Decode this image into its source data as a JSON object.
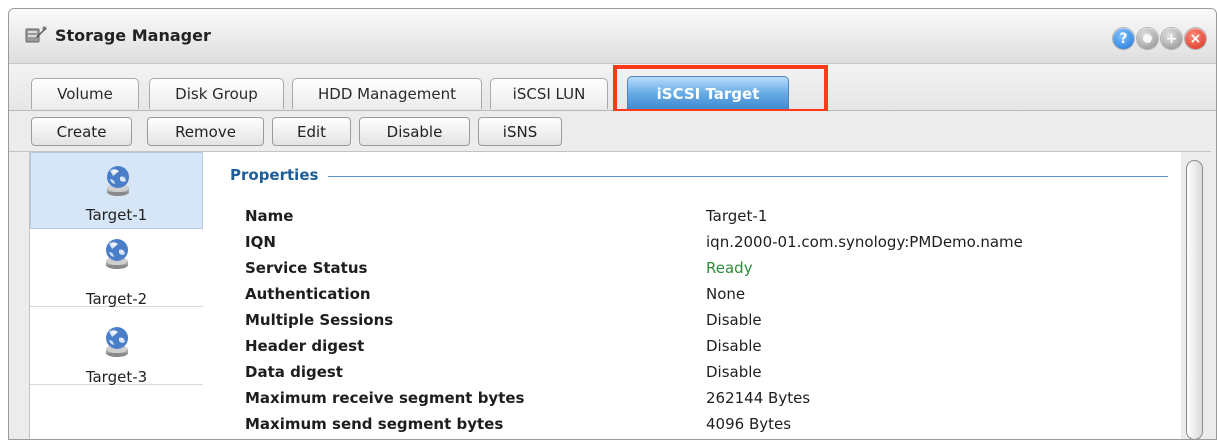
{
  "window": {
    "title": "Storage Manager",
    "icon": "storage-manager-icon",
    "controls": [
      "help-icon",
      "minimize-icon",
      "maximize-icon",
      "close-icon"
    ]
  },
  "tabs": [
    {
      "label": "Volume",
      "active": false
    },
    {
      "label": "Disk Group",
      "active": false
    },
    {
      "label": "HDD Management",
      "active": false
    },
    {
      "label": "iSCSI LUN",
      "active": false
    },
    {
      "label": "iSCSI Target",
      "active": true
    }
  ],
  "toolbar": {
    "create": "Create",
    "remove": "Remove",
    "edit": "Edit",
    "disable": "Disable",
    "isns": "iSNS"
  },
  "targets": [
    {
      "label": "Target-1",
      "icon": "globe-drive-icon",
      "selected": true
    },
    {
      "label": "Target-2",
      "icon": "globe-drive-icon",
      "selected": false
    },
    {
      "label": "Target-3",
      "icon": "globe-drive-icon",
      "selected": false
    }
  ],
  "properties": {
    "legend": "Properties",
    "rows": [
      {
        "key": "Name",
        "value": "Target-1"
      },
      {
        "key": "IQN",
        "value": "iqn.2000-01.com.synology:PMDemo.name"
      },
      {
        "key": "Service Status",
        "value": "Ready"
      },
      {
        "key": "Authentication",
        "value": "None"
      },
      {
        "key": "Multiple Sessions",
        "value": "Disable"
      },
      {
        "key": "Header digest",
        "value": "Disable"
      },
      {
        "key": "Data digest",
        "value": "Disable"
      },
      {
        "key": "Maximum receive segment bytes",
        "value": "262144 Bytes"
      },
      {
        "key": "Maximum send segment bytes",
        "value": "4096 Bytes"
      }
    ]
  },
  "colors": {
    "ready_status": "#2e8b3a",
    "active_tab": "#3b86cf",
    "highlight_box": "#ff3a1a",
    "selected_item": "#d6e6f7",
    "legend_text": "#1d5e99"
  }
}
